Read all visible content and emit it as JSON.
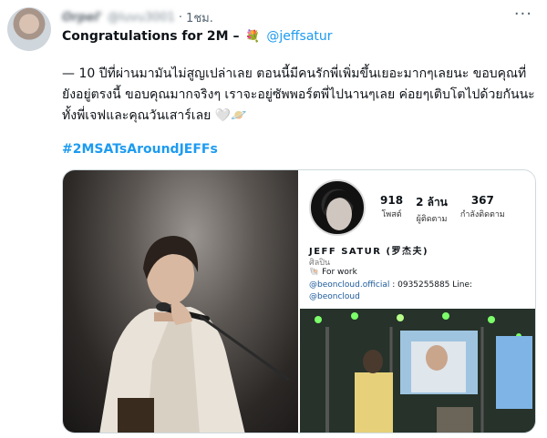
{
  "tweet": {
    "display_name": "Orpel'",
    "handle": "@luvu3001",
    "separator": "·",
    "time": "1ชม.",
    "more": "···",
    "headline_text": "Congratulations for 2M –",
    "headline_emoji": "💐",
    "mention": "@jeffsatur",
    "body_text": "— 10 ปีที่ผ่านมามันไม่สูญเปล่าเลย ตอนนี้มีคนรักพี่เพิ่มขึ้นเยอะมากๆเลยนะ ขอบคุณที่ยังอยู่ตรงนี้ ขอบคุณมากจริงๆ เราจะอยู่ซัพพอร์ตพี่ไปนานๆเลย ค่อยๆเติบโตไปด้วยกันนะ ทั้งพี่เจฟและคุณวันเสาร์เลย 🤍🪐",
    "hashtag": "#2MSATsAroundJEFFs"
  },
  "profile_card": {
    "stats": [
      {
        "num": "918",
        "label": "โพสต์"
      },
      {
        "num": "2 ล้าน",
        "label": "ผู้ติดตาม"
      },
      {
        "num": "367",
        "label": "กำลังติดตาม"
      }
    ],
    "name": "JEFF SATUR (罗杰夫)",
    "category": "ศิลปิน",
    "work_emoji": "🐚",
    "work_text": "For work",
    "link_line1_handle": "@beoncloud.official",
    "link_line1_rest": " : 0935255885 Line:",
    "link_line2_handle": "@beoncloud"
  },
  "colors": {
    "accent": "#1d9bf0",
    "text": "#0f1419",
    "muted": "#536471",
    "border": "#cfd9de"
  }
}
